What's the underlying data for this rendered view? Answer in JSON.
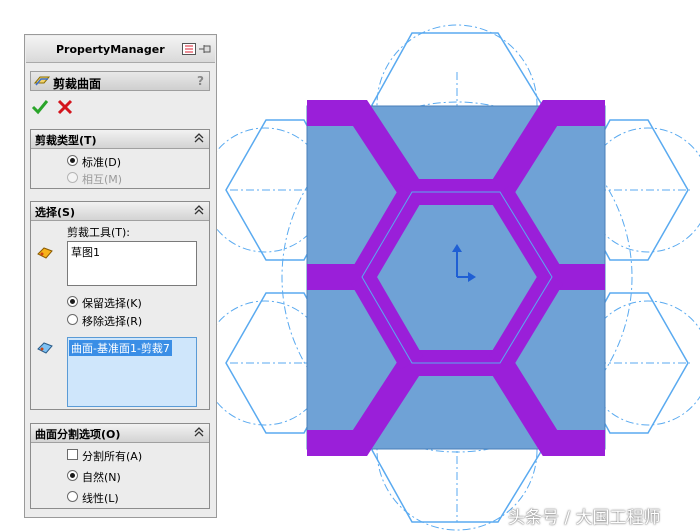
{
  "property_manager": {
    "title": "PropertyManager",
    "feature": {
      "title": "剪裁曲面",
      "help": "?"
    },
    "trim_type": {
      "label": "剪裁类型(T)",
      "options": [
        {
          "label": "标准(D)",
          "selected": true,
          "enabled": true
        },
        {
          "label": "相互(M)",
          "selected": false,
          "enabled": false
        }
      ]
    },
    "selections": {
      "label": "选择(S)",
      "trim_tool_label": "剪裁工具(T):",
      "trim_tool_value": "草图1",
      "keep_remove": [
        {
          "label": "保留选择(K)",
          "selected": true
        },
        {
          "label": "移除选择(R)",
          "selected": false
        }
      ],
      "pieces_value": "曲面-基准面1-剪裁7"
    },
    "split_options": {
      "label": "曲面分割选项(O)",
      "split_all": {
        "label": "分割所有(A)",
        "checked": false
      },
      "options": [
        {
          "label": "自然(N)",
          "selected": true
        },
        {
          "label": "线性(L)",
          "selected": false
        }
      ]
    }
  },
  "watermark": "头条号 / 大国工程师",
  "colors": {
    "surface_fill": "#6fa2d6",
    "trim_strip": "#9a1fd9",
    "sketch_line": "#5aaaf0"
  }
}
